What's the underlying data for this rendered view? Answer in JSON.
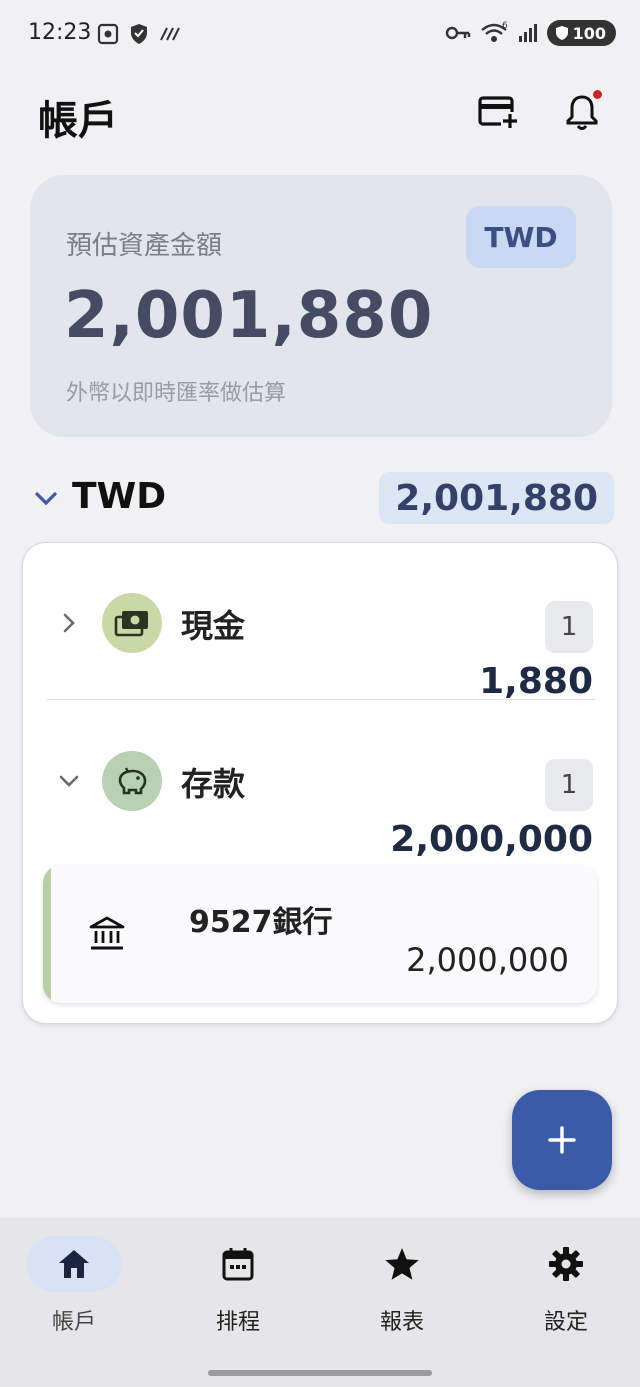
{
  "status_bar": {
    "time": "12:23",
    "battery": "100",
    "wifi_badge": "6"
  },
  "header": {
    "title": "帳戶",
    "add_card_icon": "add-card-icon",
    "notification_icon": "bell-icon"
  },
  "summary": {
    "label": "預估資產金額",
    "amount": "2,001,880",
    "note": "外幣以即時匯率做估算",
    "currency": "TWD"
  },
  "currency_section": {
    "title": "TWD",
    "total": "2,001,880",
    "groups": [
      {
        "name": "現金",
        "count": "1",
        "amount": "1,880",
        "expanded": false,
        "avatar_color": "#c9d9a6"
      },
      {
        "name": "存款",
        "count": "1",
        "amount": "2,000,000",
        "expanded": true,
        "avatar_color": "#b9d1b2"
      }
    ],
    "deposit_accounts": [
      {
        "name": "9527銀行",
        "amount": "2,000,000",
        "icon": "bank-icon"
      }
    ]
  },
  "fab": {
    "icon": "plus-icon"
  },
  "bottom_nav": {
    "items": [
      {
        "label": "帳戶",
        "icon": "home-icon",
        "active": true
      },
      {
        "label": "排程",
        "icon": "calendar-icon",
        "active": false
      },
      {
        "label": "報表",
        "icon": "star-icon",
        "active": false
      },
      {
        "label": "設定",
        "icon": "gear-icon",
        "active": false
      }
    ]
  },
  "colors": {
    "primary": "#3a5ba8",
    "summary_bg": "#e2e5ec",
    "chip_bg": "#c9d9f4",
    "notification_dot": "#c62828"
  }
}
